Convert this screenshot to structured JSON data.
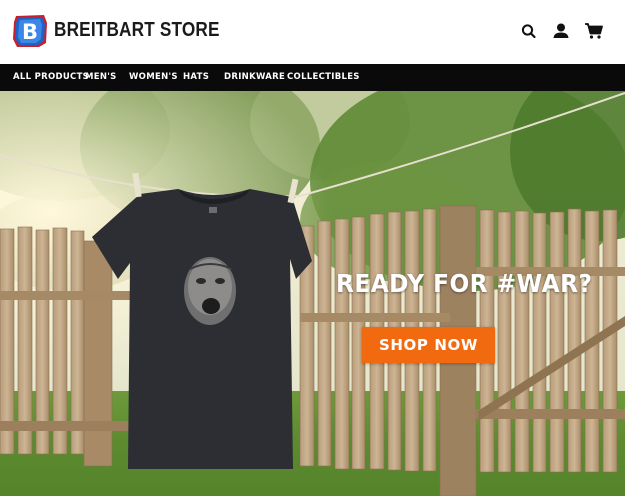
{
  "header": {
    "brand": "BREITBART STORE",
    "logo_letter": "B",
    "icons": [
      "search-icon",
      "account-icon",
      "cart-icon"
    ]
  },
  "nav": {
    "items": [
      {
        "label": "ALL PRODUCTS"
      },
      {
        "label": "MEN'S"
      },
      {
        "label": "WOMEN'S"
      },
      {
        "label": "HATS"
      },
      {
        "label": "DRINKWARE"
      },
      {
        "label": "COLLECTIBLES"
      }
    ]
  },
  "hero": {
    "headline": "READY FOR #WAR?",
    "cta_label": "SHOP NOW"
  },
  "colors": {
    "nav_background": "#0a0a0a",
    "cta_background": "#f26a10",
    "logo_blue": "#1e63c7"
  }
}
